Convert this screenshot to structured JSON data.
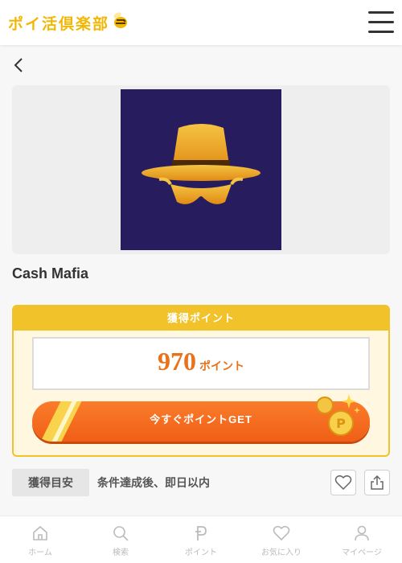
{
  "header": {
    "logo_text": "ポイ活倶楽部",
    "logo_icon": "bee-icon",
    "menu_icon": "hamburger-menu-icon"
  },
  "nav": {
    "back_icon": "chevron-left-icon"
  },
  "offer": {
    "title": "Cash Mafia",
    "image_icon": "spy-hat-glasses-icon"
  },
  "points": {
    "heading": "獲得ポイント",
    "value": "970",
    "unit": "ポイント",
    "get_button_label": "今すぐポイントGET",
    "coins_icon": "gold-coins-icon"
  },
  "timing": {
    "label": "獲得目安",
    "value": "条件達成後、即日以内",
    "favorite_icon": "heart-icon",
    "share_icon": "share-icon"
  },
  "bottom_nav": [
    {
      "label": "ホーム",
      "icon": "home-icon"
    },
    {
      "label": "検索",
      "icon": "search-icon"
    },
    {
      "label": "ポイント",
      "icon": "point-p-icon"
    },
    {
      "label": "お気に入り",
      "icon": "heart-icon"
    },
    {
      "label": "マイページ",
      "icon": "person-icon"
    }
  ],
  "colors": {
    "accent_yellow": "#f2c22a",
    "orange": "#f05f16",
    "hero_bg": "#261c5e",
    "gold": "#f2b705"
  }
}
